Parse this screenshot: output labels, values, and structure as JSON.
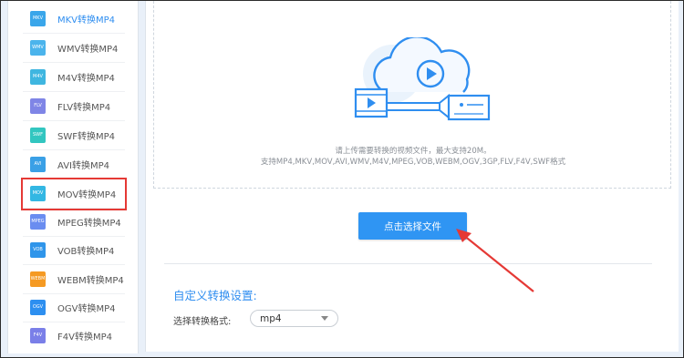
{
  "sidebar": {
    "items": [
      {
        "label": "MKV转换MP4",
        "icon_text": "MKV",
        "color": "#3aa6ea"
      },
      {
        "label": "WMV转换MP4",
        "icon_text": "WMV",
        "color": "#4bb4ec"
      },
      {
        "label": "M4V转换MP4",
        "icon_text": "M4V",
        "color": "#3fb6e0"
      },
      {
        "label": "FLV转换MP4",
        "icon_text": "FLV",
        "color": "#7f85e6"
      },
      {
        "label": "SWF转换MP4",
        "icon_text": "SWF",
        "color": "#32c6c0"
      },
      {
        "label": "AVI转换MP4",
        "icon_text": "AVI",
        "color": "#3aa0e6"
      },
      {
        "label": "MOV转换MP4",
        "icon_text": "MOV",
        "color": "#33b7e3"
      },
      {
        "label": "MPEG转换MP4",
        "icon_text": "MPEG",
        "color": "#6a8df0"
      },
      {
        "label": "VOB转换MP4",
        "icon_text": "VOB",
        "color": "#2f95ea"
      },
      {
        "label": "WEBM转换MP4",
        "icon_text": "WEBM",
        "color": "#f59a23"
      },
      {
        "label": "OGV转换MP4",
        "icon_text": "OGV",
        "color": "#2d8ff0"
      },
      {
        "label": "F4V转换MP4",
        "icon_text": "F4V",
        "color": "#7a7fe8"
      }
    ]
  },
  "upload": {
    "hint_line1": "请上传需要转换的视频文件，最大支持20M。",
    "hint_line2": "支持MP4,MKV,MOV,AVI,WMV,M4V,MPEG,VOB,WEBM,OGV,3GP,FLV,F4V,SWF格式",
    "button_label": "点击选择文件"
  },
  "settings": {
    "title": "自定义转换设置:",
    "format_label": "选择转换格式:",
    "format_value": "mp4"
  },
  "colors": {
    "accent": "#2f8ef0",
    "highlight_box": "#e53935",
    "arrow": "#e53935"
  }
}
